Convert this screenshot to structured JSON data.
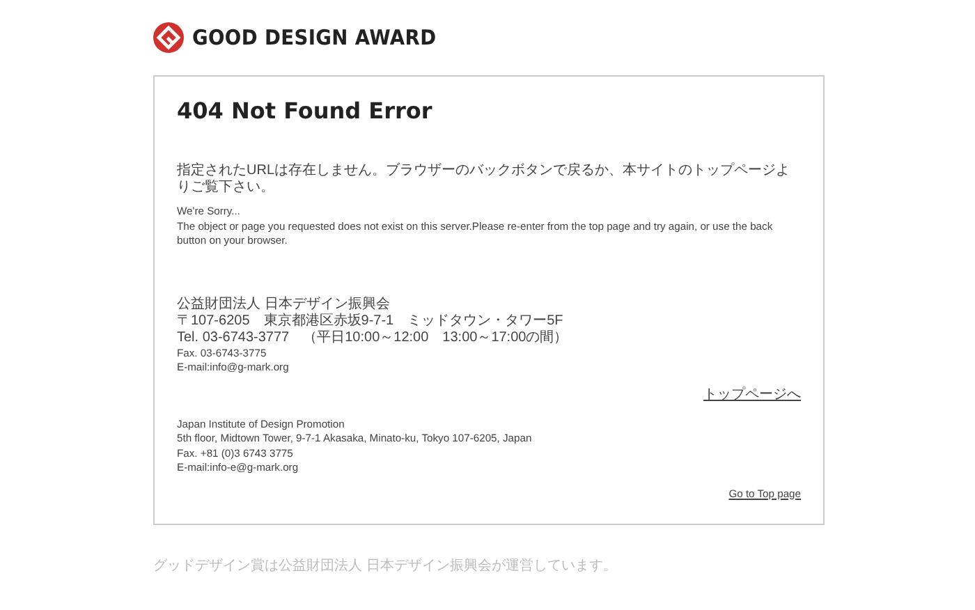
{
  "logo": {
    "text": "GOOD DESIGN AWARD"
  },
  "card": {
    "title": "404 Not Found Error",
    "message_ja": "指定されたURLは存在しません。ブラウザーのバックボタンで戻るか、本サイトのトップページよりご覧下さい。",
    "message_en": [
      "We're Sorry...",
      "The object or page you requested does not exist on this server.Please re-enter from the top page and try again, or use the back button on your browser."
    ],
    "contacts": [
      {
        "lines": [
          "公益財団法人 日本デザイン振興会",
          "〒107-6205　東京都港区赤坂9-7-1　ミッドタウン・タワー5F",
          "Tel. 03-6743-3777　（平日10:00～12:00　13:00～17:00の間）",
          "Fax. 03-6743-3775",
          "E-mail:info@g-mark.org"
        ],
        "link": "トップページへ"
      },
      {
        "lines": [
          "Japan Institute of Design Promotion",
          "5th floor, Midtown Tower, 9-7-1 Akasaka, Minato-ku, Tokyo 107-6205, Japan",
          "Fax. +81 (0)3 6743 3775",
          "E-mail:info-e@g-mark.org"
        ],
        "link": "Go to Top page"
      }
    ]
  },
  "footer": "グッドデザイン賞は公益財団法人 日本デザイン振興会が運営しています。"
}
